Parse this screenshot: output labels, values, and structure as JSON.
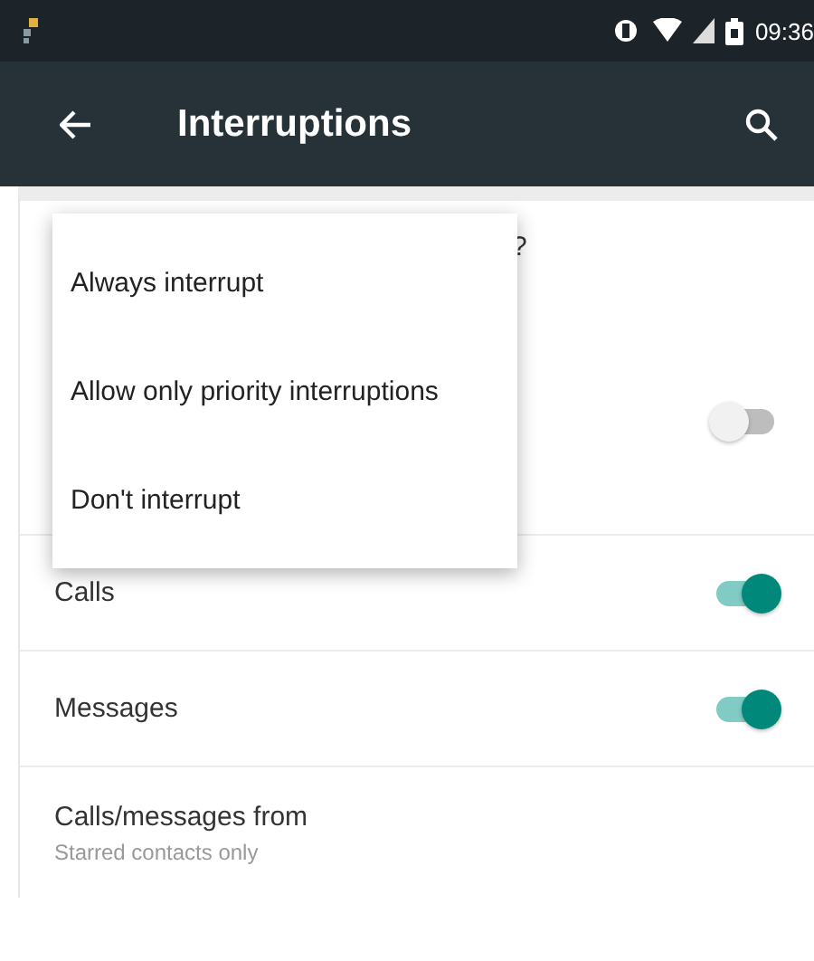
{
  "status_bar": {
    "time": "09:36"
  },
  "toolbar": {
    "title": "Interruptions"
  },
  "hidden_row": {
    "text_tail": "?"
  },
  "hidden_switch": {
    "on": false
  },
  "menu": {
    "items": [
      {
        "label": "Always interrupt"
      },
      {
        "label": "Allow only priority interruptions"
      },
      {
        "label": "Don't interrupt"
      }
    ]
  },
  "settings": [
    {
      "kind": "switch",
      "label": "Calls",
      "on": true
    },
    {
      "kind": "switch",
      "label": "Messages",
      "on": true
    },
    {
      "kind": "detail",
      "label": "Calls/messages from",
      "summary": "Starred contacts only"
    }
  ]
}
